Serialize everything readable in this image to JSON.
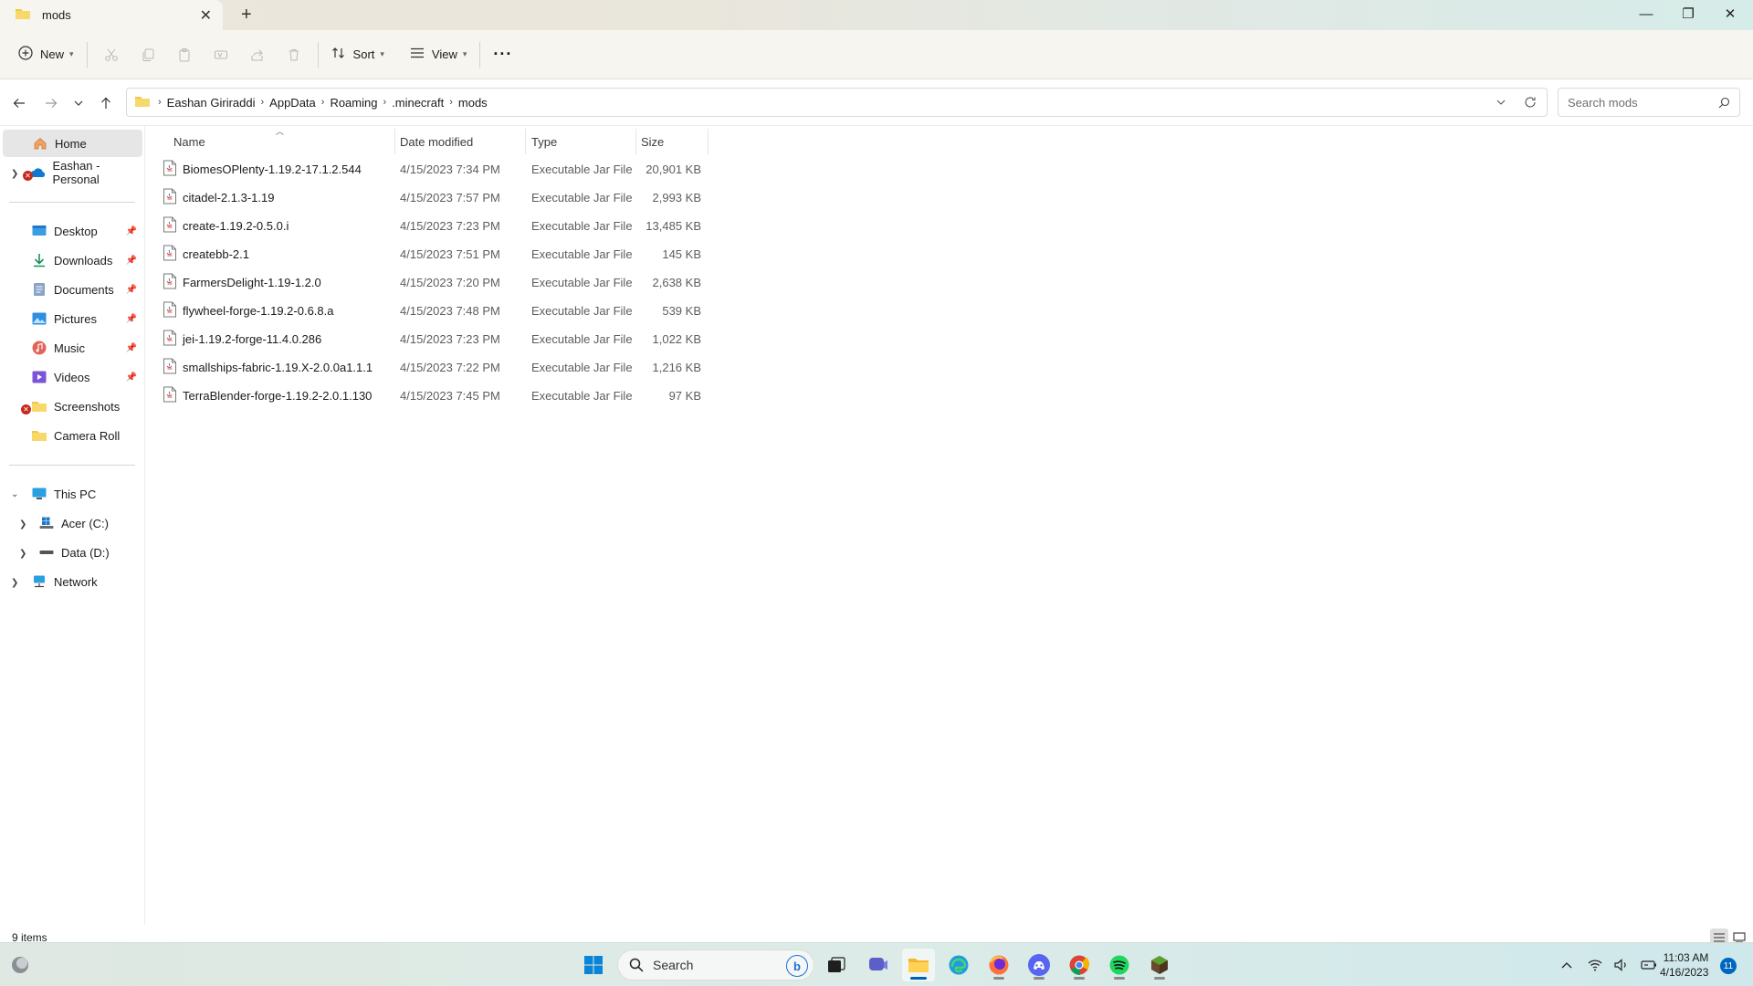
{
  "window": {
    "tab_title": "mods",
    "new_tab_symbol": "+",
    "close_tab_symbol": "✕",
    "controls": {
      "minimize": "—",
      "maximize": "❐",
      "close": "✕"
    }
  },
  "toolbar": {
    "new_label": "New",
    "sort_label": "Sort",
    "view_label": "View",
    "more_label": "···",
    "disabled_icons": [
      "cut-icon",
      "copy-icon",
      "paste-icon",
      "rename-icon",
      "share-icon",
      "delete-icon"
    ]
  },
  "address": {
    "crumbs": [
      "Eashan Giriraddi",
      "AppData",
      "Roaming",
      ".minecraft",
      "mods"
    ],
    "separator": "›"
  },
  "search": {
    "placeholder": "Search mods"
  },
  "nav": {
    "home": "Home",
    "onedrive": "Eashan - Personal",
    "quick_access": [
      "Desktop",
      "Downloads",
      "Documents",
      "Pictures",
      "Music",
      "Videos",
      "Screenshots",
      "Camera Roll"
    ],
    "this_pc": "This PC",
    "drive_c": "Acer (C:)",
    "drive_d": "Data  (D:)",
    "network": "Network"
  },
  "columns": {
    "name": "Name",
    "date": "Date modified",
    "type": "Type",
    "size": "Size"
  },
  "files": [
    {
      "name": "BiomesOPlenty-1.19.2-17.1.2.544",
      "date": "4/15/2023 7:34 PM",
      "type": "Executable Jar File",
      "size": "20,901 KB"
    },
    {
      "name": "citadel-2.1.3-1.19",
      "date": "4/15/2023 7:57 PM",
      "type": "Executable Jar File",
      "size": "2,993 KB"
    },
    {
      "name": "create-1.19.2-0.5.0.i",
      "date": "4/15/2023 7:23 PM",
      "type": "Executable Jar File",
      "size": "13,485 KB"
    },
    {
      "name": "createbb-2.1",
      "date": "4/15/2023 7:51 PM",
      "type": "Executable Jar File",
      "size": "145 KB"
    },
    {
      "name": "FarmersDelight-1.19-1.2.0",
      "date": "4/15/2023 7:20 PM",
      "type": "Executable Jar File",
      "size": "2,638 KB"
    },
    {
      "name": "flywheel-forge-1.19.2-0.6.8.a",
      "date": "4/15/2023 7:48 PM",
      "type": "Executable Jar File",
      "size": "539 KB"
    },
    {
      "name": "jei-1.19.2-forge-11.4.0.286",
      "date": "4/15/2023 7:23 PM",
      "type": "Executable Jar File",
      "size": "1,022 KB"
    },
    {
      "name": "smallships-fabric-1.19.X-2.0.0a1.1.1",
      "date": "4/15/2023 7:22 PM",
      "type": "Executable Jar File",
      "size": "1,216 KB"
    },
    {
      "name": "TerraBlender-forge-1.19.2-2.0.1.130",
      "date": "4/15/2023 7:45 PM",
      "type": "Executable Jar File",
      "size": "97 KB"
    }
  ],
  "status": {
    "count": "9 items"
  },
  "taskbar": {
    "search_label": "Search",
    "time": "11:03 AM",
    "date": "4/16/2023",
    "notifications": "11",
    "apps": [
      "start-icon",
      "file-explorer-app",
      "edge-app",
      "firefox-app",
      "discord-app",
      "chrome-app",
      "spotify-app",
      "minecraft-app"
    ]
  },
  "colors": {
    "accent": "#0067c0",
    "folder": "#f2c94c",
    "selected": "#e6e6e6",
    "error_badge": "#c42b1c"
  }
}
